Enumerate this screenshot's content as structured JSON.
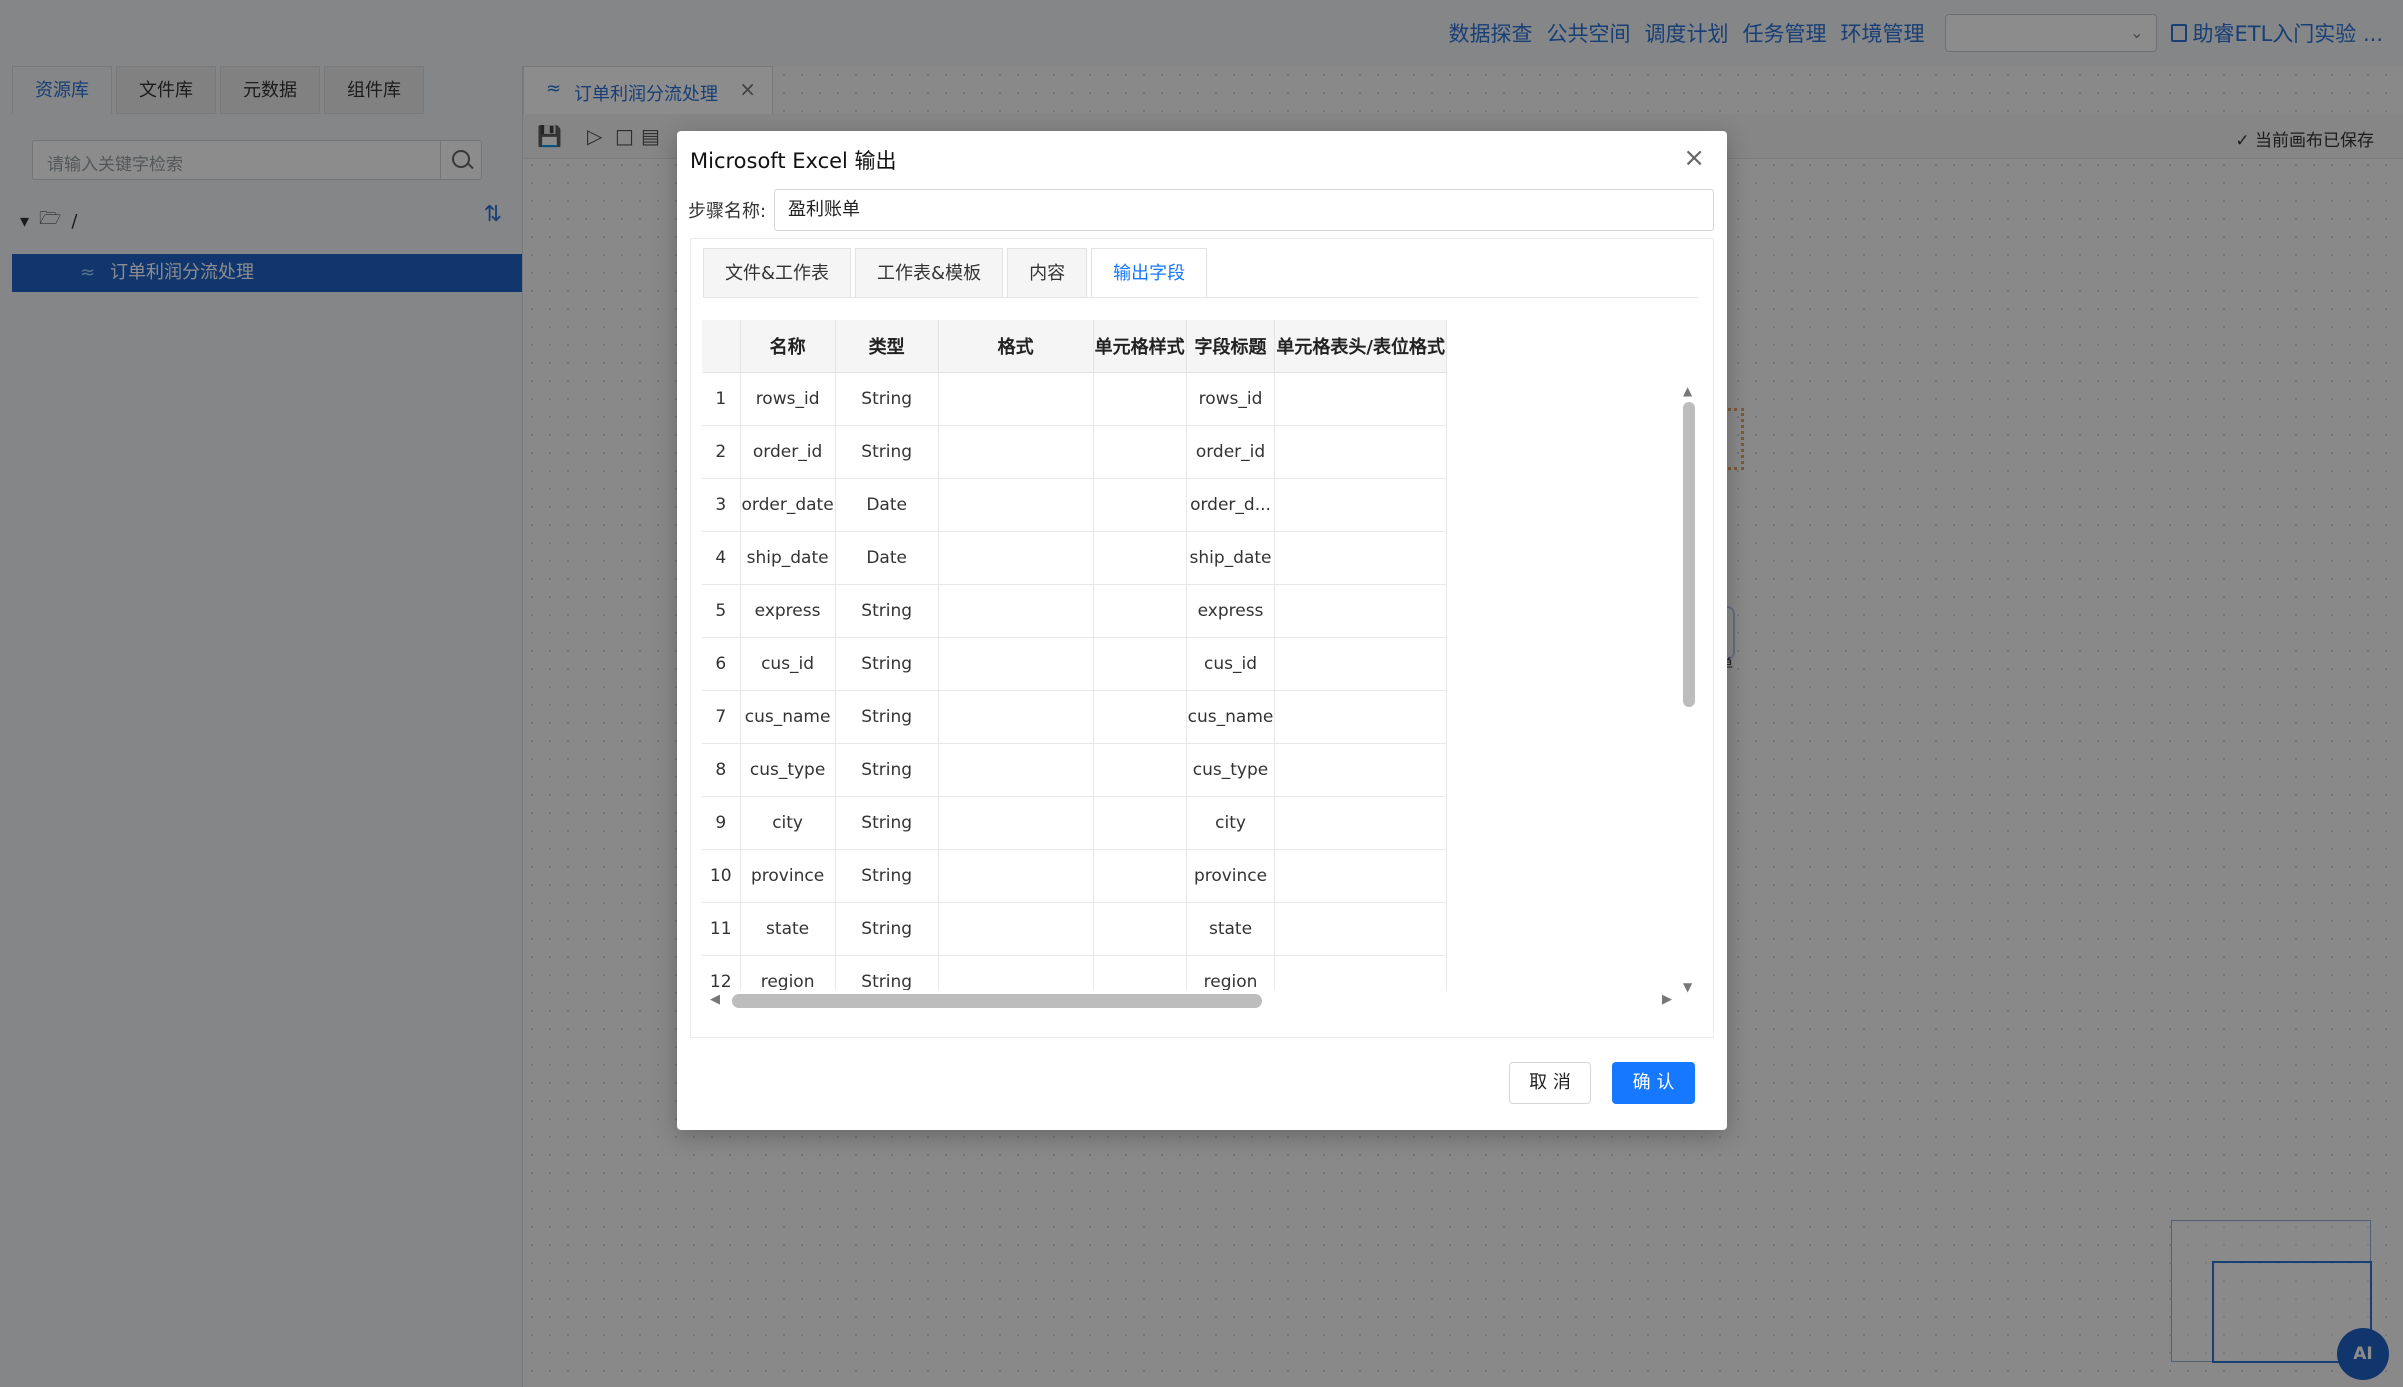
{
  "header": {
    "nav": [
      "数据探查",
      "公共空间",
      "调度计划",
      "任务管理",
      "环境管理"
    ],
    "env_value": "",
    "help_link": "助睿ETL入门实验 ..."
  },
  "left_panel": {
    "tabs": [
      "资源库",
      "文件库",
      "元数据",
      "组件库"
    ],
    "search_placeholder": "请输入关键字检索",
    "root_path": "/",
    "selected_item": "订单利润分流处理"
  },
  "canvas": {
    "tab_title": "订单利润分流处理",
    "save_status": "当前画布已保存",
    "node_label_partial": "单",
    "ai_button": "AI"
  },
  "dialog": {
    "title": "Microsoft Excel 输出",
    "step_label": "步骤名称:",
    "step_value": "盈利账单",
    "tabs": [
      "文件&工作表",
      "工作表&模板",
      "内容",
      "输出字段"
    ],
    "active_tab": "输出字段",
    "columns": [
      "",
      "名称",
      "类型",
      "格式",
      "单元格样式",
      "字段标题",
      "单元格表头/表位格式"
    ],
    "rows": [
      {
        "no": "1",
        "name": "rows_id",
        "type": "String",
        "format": "",
        "style": "",
        "title": "rows_id",
        "header_format": ""
      },
      {
        "no": "2",
        "name": "order_id",
        "type": "String",
        "format": "",
        "style": "",
        "title": "order_id",
        "header_format": ""
      },
      {
        "no": "3",
        "name": "order_date",
        "type": "Date",
        "format": "",
        "style": "",
        "title": "order_d...",
        "header_format": ""
      },
      {
        "no": "4",
        "name": "ship_date",
        "type": "Date",
        "format": "",
        "style": "",
        "title": "ship_date",
        "header_format": ""
      },
      {
        "no": "5",
        "name": "express",
        "type": "String",
        "format": "",
        "style": "",
        "title": "express",
        "header_format": ""
      },
      {
        "no": "6",
        "name": "cus_id",
        "type": "String",
        "format": "",
        "style": "",
        "title": "cus_id",
        "header_format": ""
      },
      {
        "no": "7",
        "name": "cus_name",
        "type": "String",
        "format": "",
        "style": "",
        "title": "cus_name",
        "header_format": ""
      },
      {
        "no": "8",
        "name": "cus_type",
        "type": "String",
        "format": "",
        "style": "",
        "title": "cus_type",
        "header_format": ""
      },
      {
        "no": "9",
        "name": "city",
        "type": "String",
        "format": "",
        "style": "",
        "title": "city",
        "header_format": ""
      },
      {
        "no": "10",
        "name": "province",
        "type": "String",
        "format": "",
        "style": "",
        "title": "province",
        "header_format": ""
      },
      {
        "no": "11",
        "name": "state",
        "type": "String",
        "format": "",
        "style": "",
        "title": "state",
        "header_format": ""
      },
      {
        "no": "12",
        "name": "region",
        "type": "String",
        "format": "",
        "style": "",
        "title": "region",
        "header_format": ""
      }
    ],
    "cancel_label": "取 消",
    "confirm_label": "确 认"
  },
  "colors": {
    "accent": "#1677ff",
    "link": "#2b73d8",
    "selected_row": "#1f63c9"
  }
}
